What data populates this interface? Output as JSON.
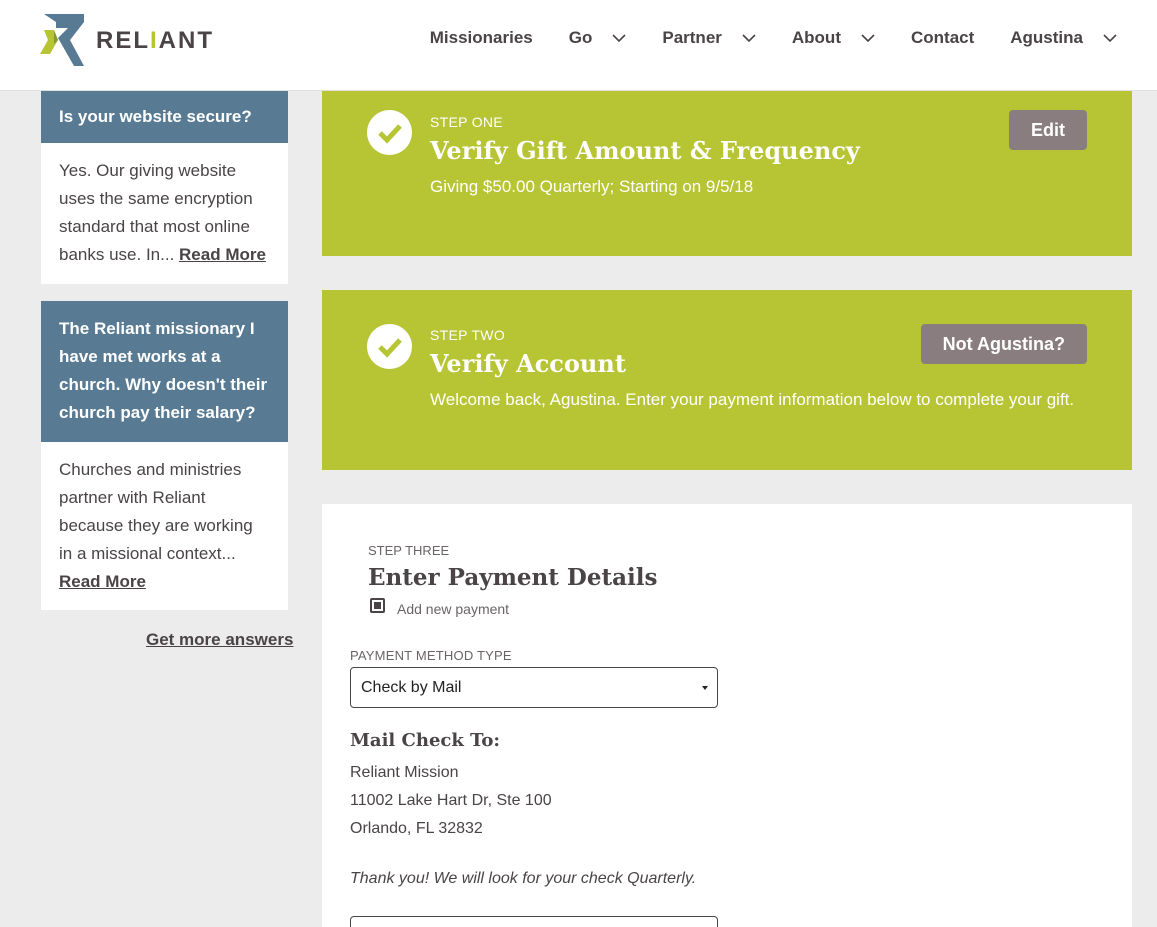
{
  "brand": {
    "name_pre": "REL",
    "name_accent": "I",
    "name_post": "ANT",
    "accent_color": "#b7c434",
    "blue_color": "#587a93"
  },
  "nav": {
    "items": [
      {
        "label": "Missionaries",
        "has_dropdown": false
      },
      {
        "label": "Go",
        "has_dropdown": true
      },
      {
        "label": "Partner",
        "has_dropdown": true
      },
      {
        "label": "About",
        "has_dropdown": true
      },
      {
        "label": "Contact",
        "has_dropdown": false
      },
      {
        "label": "Agustina",
        "has_dropdown": true
      }
    ]
  },
  "sidebar": {
    "faqs": [
      {
        "question": "Is your website secure?",
        "answer": "Yes. Our giving website uses the same encryption standard that most online banks use. In...",
        "read_more": "Read More"
      },
      {
        "question": "The Reliant missionary I have met works at a church. Why doesn't their church pay their salary?",
        "answer": "Churches and ministries partner with Reliant because they are working in a missional context...",
        "read_more": "Read More"
      }
    ],
    "more_answers": "Get more answers"
  },
  "steps": {
    "one": {
      "label": "STEP ONE",
      "title": "Verify Gift Amount & Frequency",
      "description": "Giving $50.00 Quarterly; Starting on 9/5/18",
      "button": "Edit"
    },
    "two": {
      "label": "STEP TWO",
      "title": "Verify Account",
      "description": "Welcome back, Agustina. Enter your payment information below to complete your gift.",
      "button": "Not Agustina?"
    },
    "three": {
      "label": "STEP THREE",
      "title": "Enter Payment Details",
      "add_new_payment": "Add new payment",
      "add_new_payment_checked": true,
      "payment_method_label": "PAYMENT METHOD TYPE",
      "payment_method_value": "Check by Mail",
      "mail_title": "Mail Check To:",
      "address": [
        "Reliant Mission",
        "11002 Lake Hart Dr, Ste 100",
        "Orlando, FL 32832"
      ],
      "thanks": "Thank you! We will look for your check Quarterly."
    }
  }
}
